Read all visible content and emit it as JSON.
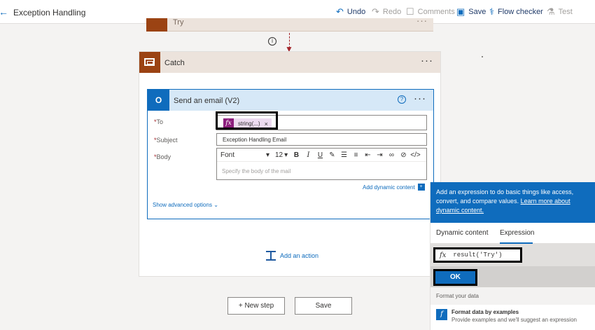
{
  "topbar": {
    "title": "Exception Handling",
    "undo": "Undo",
    "redo": "Redo",
    "comments": "Comments",
    "save": "Save",
    "flow_checker": "Flow checker",
    "test": "Test"
  },
  "try_card": {
    "label": "Try"
  },
  "catch": {
    "label": "Catch"
  },
  "action": {
    "title": "Send an email (V2)",
    "to_label": "To",
    "to_token": "string(...)",
    "subject_label": "Subject",
    "subject_value": "Exception Handling Email",
    "body_label": "Body",
    "font_value": "Font",
    "font_size": "12",
    "body_placeholder": "Specify the body of the mail",
    "add_dynamic": "Add dynamic content",
    "show_advanced": "Show advanced options"
  },
  "add_action": "Add an action",
  "new_step": "+ New step",
  "save_button": "Save",
  "panel": {
    "intro": "Add an expression to do basic things like access, convert, and compare values.",
    "learn_more": "Learn more about dynamic content.",
    "tab_dynamic": "Dynamic content",
    "tab_expression": "Expression",
    "expression_value": "result('Try')",
    "ok": "OK",
    "format_label": "Format your data",
    "fbe_title": "Format data by examples",
    "fbe_desc": "Provide examples and we'll suggest an expression"
  },
  "colors": {
    "accent": "#0f6cbd",
    "scope": "#9b4313",
    "token": "#8c1d7c"
  }
}
